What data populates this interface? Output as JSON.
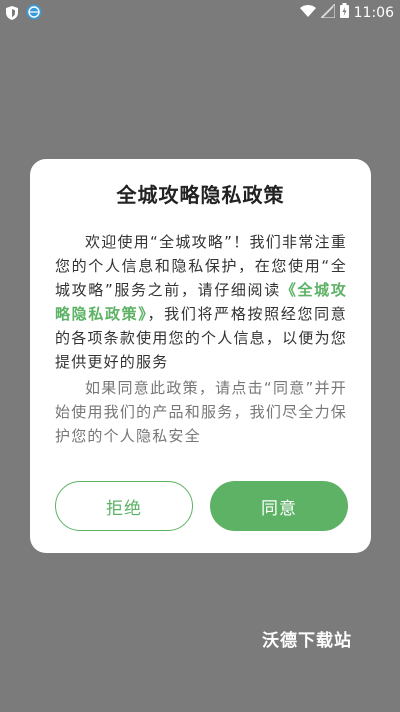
{
  "status_bar": {
    "time": "11:06",
    "icons": [
      "shield-icon",
      "browser-app-icon",
      "wifi-icon",
      "signal-icon",
      "battery-charging-icon"
    ]
  },
  "dialog": {
    "title": "全城攻略隐私政策",
    "para1_part1": "欢迎使用“全城攻略”！我们非常注重您的个人信息和隐私保护，在您使用“全城攻略”服务之前，请仔细阅读",
    "policy_link": "《全城攻略隐私政策》",
    "para1_part2": "，我们将严格按照经您同意的各项条款使用您的个人信息，以便为您提供更好的服务",
    "para2": "如果同意此政策，请点击“同意”并开始使用我们的产品和服务，我们尽全力保护您的个人隐私安全",
    "decline_label": "拒绝",
    "agree_label": "同意"
  },
  "watermark": "沃德下载站",
  "colors": {
    "overlay": "#7b7b7b",
    "accent": "#5db265",
    "dialog_bg": "#ffffff"
  }
}
